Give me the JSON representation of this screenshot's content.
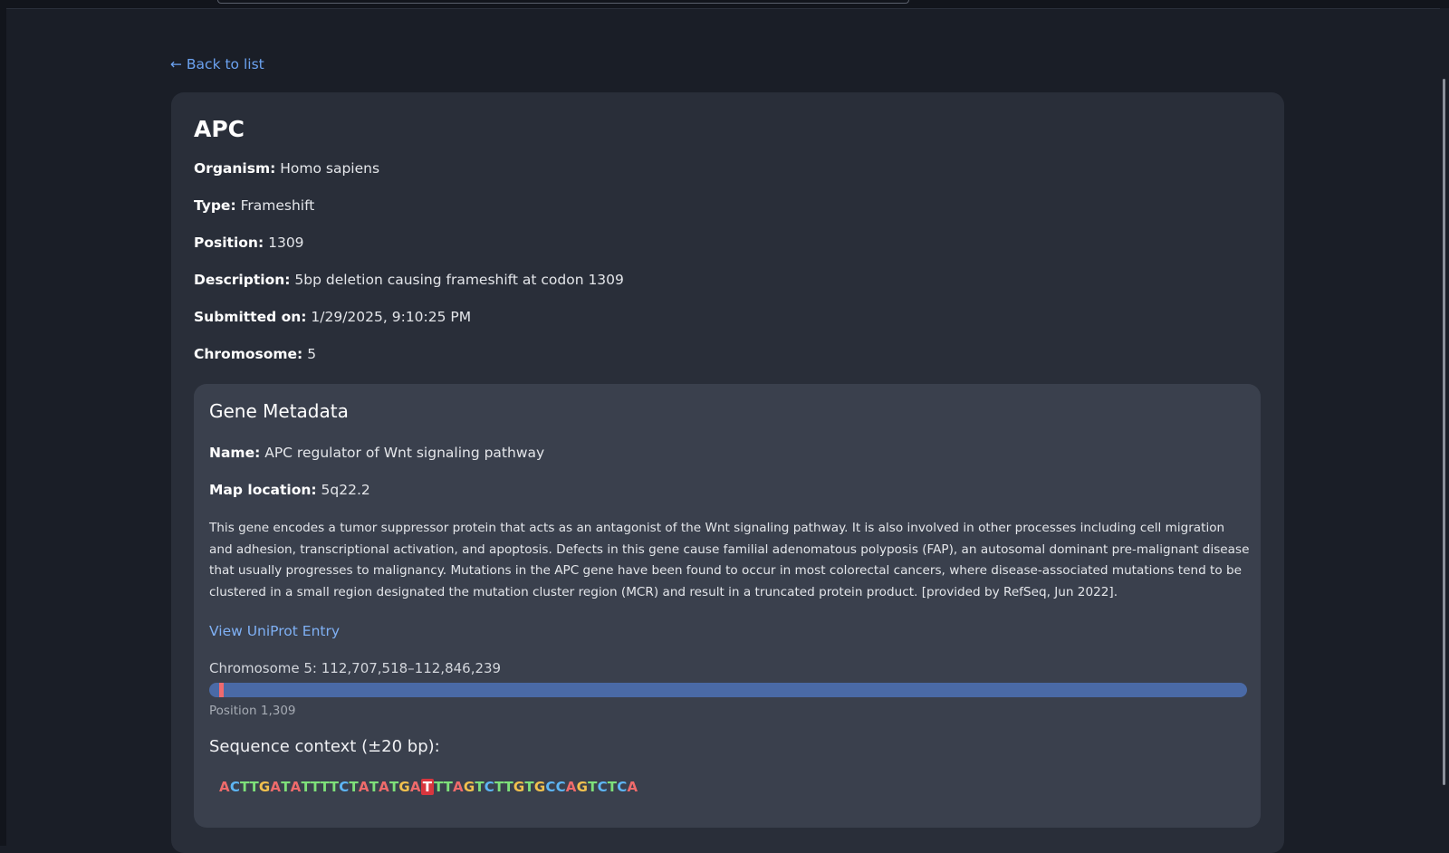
{
  "nav": {
    "back_label": "← Back to list"
  },
  "gene": {
    "symbol": "APC",
    "fields": [
      {
        "label": "Organism:",
        "value": "Homo sapiens"
      },
      {
        "label": "Type:",
        "value": "Frameshift"
      },
      {
        "label": "Position:",
        "value": "1309"
      },
      {
        "label": "Description:",
        "value": "5bp deletion causing frameshift at codon 1309"
      },
      {
        "label": "Submitted on:",
        "value": "1/29/2025, 9:10:25 PM"
      },
      {
        "label": "Chromosome:",
        "value": "5"
      }
    ]
  },
  "metadata": {
    "heading": "Gene Metadata",
    "name_label": "Name:",
    "name_value": "APC regulator of Wnt signaling pathway",
    "map_label": "Map location:",
    "map_value": "5q22.2",
    "summary": "This gene encodes a tumor suppressor protein that acts as an antagonist of the Wnt signaling pathway. It is also involved in other processes including cell migration and adhesion, transcriptional activation, and apoptosis. Defects in this gene cause familial adenomatous polyposis (FAP), an autosomal dominant pre-malignant disease that usually progresses to malignancy. Mutations in the APC gene have been found to occur in most colorectal cancers, where disease-associated mutations tend to be clustered in a small region designated the mutation cluster region (MCR) and result in a truncated protein product. [provided by RefSeq, Jun 2022].",
    "uniprot_label": "View UniProt Entry",
    "chromosome_range": "Chromosome 5: 112,707,518–112,846,239",
    "position_label": "Position 1,309",
    "marker_fraction": 0.0094,
    "sequence_heading": "Sequence context (±20 bp):",
    "sequence": "ACTTGATATTTTCTATATGATTTAGTCTTGTGCCAGTCTCA",
    "highlight_index": 20
  },
  "colors": {
    "A": "#ef6b6b",
    "C": "#5eb6f5",
    "G": "#f2c14e",
    "T": "#7ee07a",
    "accent": "#6ba2f0",
    "track": "#4a6aa6",
    "marker": "#ef6a6e"
  }
}
